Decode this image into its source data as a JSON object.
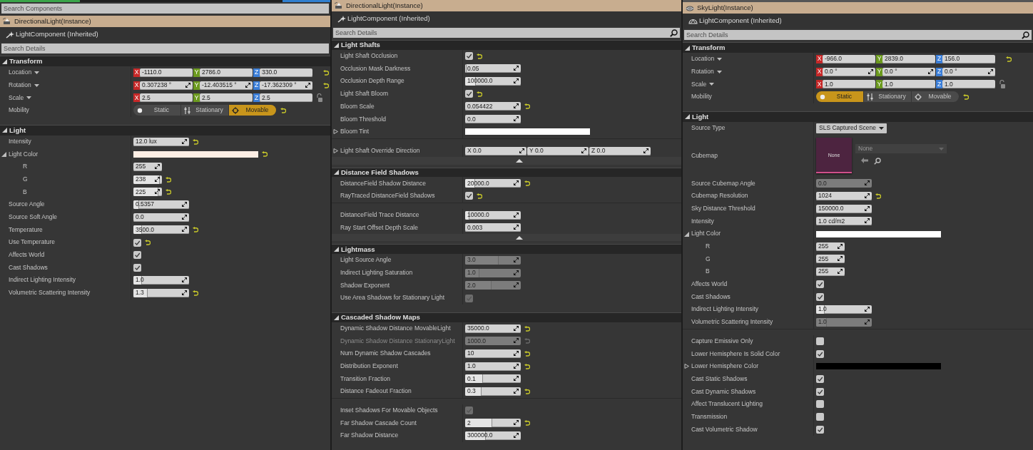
{
  "panels": [
    {
      "search_components": {
        "placeholder": "Search Components"
      },
      "actor": {
        "kind": "directional",
        "title": "DirectionalLight(Instance)"
      },
      "component": "LightComponent (Inherited)",
      "search": {
        "placeholder": "Search Details"
      },
      "sections": [
        {
          "title": "Transform",
          "expanded": true,
          "groups": [
            {
              "rows": [
                {
                  "label": "Location",
                  "kind": "vector",
                  "menu": true,
                  "reset": true,
                  "fields": [
                    {
                      "axis": "X",
                      "color": "#c62828",
                      "value": "-1110.0"
                    },
                    {
                      "axis": "Y",
                      "color": "#6c9a1f",
                      "value": "2786.0"
                    },
                    {
                      "axis": "Z",
                      "color": "#3b7ed8",
                      "value": "330.0"
                    }
                  ]
                },
                {
                  "label": "Rotation",
                  "kind": "vector",
                  "menu": true,
                  "spin": true,
                  "reset": true,
                  "fields": [
                    {
                      "axis": "X",
                      "color": "#c62828",
                      "value": "0.307238 °"
                    },
                    {
                      "axis": "Y",
                      "color": "#6c9a1f",
                      "value": "-12.403515 °"
                    },
                    {
                      "axis": "Z",
                      "color": "#3b7ed8",
                      "value": "-17.362309 °"
                    }
                  ]
                },
                {
                  "label": "Scale",
                  "kind": "vector",
                  "menu": true,
                  "lock": true,
                  "fields": [
                    {
                      "axis": "X",
                      "color": "#c62828",
                      "value": "2.5"
                    },
                    {
                      "axis": "Y",
                      "color": "#6c9a1f",
                      "value": "2.5"
                    },
                    {
                      "axis": "Z",
                      "color": "#3b7ed8",
                      "value": "2.5"
                    }
                  ]
                },
                {
                  "label": "Mobility",
                  "kind": "mobility",
                  "reset": true,
                  "options": [
                    {
                      "label": "Static",
                      "selected": false
                    },
                    {
                      "label": "Stationary",
                      "selected": false
                    },
                    {
                      "label": "Movable",
                      "selected": true
                    }
                  ]
                }
              ]
            }
          ]
        },
        {
          "title": "Light",
          "expanded": true,
          "groups": [
            {
              "rows": [
                {
                  "label": "Intensity",
                  "kind": "number",
                  "value": "12.0 lux",
                  "reset": true
                },
                {
                  "label": "Light Color",
                  "kind": "color",
                  "color": "#fdeee4",
                  "expanded": true,
                  "reset": true,
                  "children": [
                    {
                      "label": "R",
                      "kind": "number",
                      "value": "255"
                    },
                    {
                      "label": "G",
                      "kind": "number",
                      "value": "238",
                      "level": 0.93,
                      "reset": true
                    },
                    {
                      "label": "B",
                      "kind": "number",
                      "value": "225",
                      "level": 0.88,
                      "reset": true
                    }
                  ]
                },
                {
                  "label": "Source Angle",
                  "kind": "number",
                  "value": "0.5357",
                  "level": 0.1
                },
                {
                  "label": "Source Soft Angle",
                  "kind": "number",
                  "value": "0.0"
                },
                {
                  "label": "Temperature",
                  "kind": "number",
                  "value": "3500.0",
                  "level": 0.16,
                  "reset": true
                },
                {
                  "label": "Use Temperature",
                  "kind": "check",
                  "checked": true,
                  "reset": true
                },
                {
                  "label": "Affects World",
                  "kind": "check",
                  "checked": true
                },
                {
                  "label": "Cast Shadows",
                  "kind": "check",
                  "checked": true
                },
                {
                  "label": "Indirect Lighting Intensity",
                  "kind": "number",
                  "value": "1.0",
                  "level": 0.16
                },
                {
                  "label": "Volumetric Scattering Intensity",
                  "kind": "number",
                  "value": "1.3",
                  "level": 0.26,
                  "reset": true
                }
              ]
            }
          ]
        }
      ]
    },
    {
      "actor": {
        "kind": "directional",
        "title": "DirectionalLight(Instance)"
      },
      "component": "LightComponent (Inherited)",
      "search": {
        "placeholder": "Search Details",
        "button": true
      },
      "sections": [
        {
          "title": "Light Shafts",
          "expanded": true,
          "advanced": {
            "expanded": true
          },
          "groups": [
            {
              "rows": [
                {
                  "label": "Light Shaft Occlusion",
                  "kind": "check",
                  "checked": true,
                  "reset": true
                },
                {
                  "label": "Occlusion Mask Darkness",
                  "kind": "number",
                  "value": "0.05",
                  "level": 0.03
                },
                {
                  "label": "Occlusion Depth Range",
                  "kind": "number",
                  "value": "100000.0",
                  "level": 0.19
                },
                {
                  "label": "Light Shaft Bloom",
                  "kind": "check",
                  "checked": true,
                  "reset": true
                },
                {
                  "label": "Bloom Scale",
                  "kind": "number",
                  "value": "0.054422",
                  "reset": true
                },
                {
                  "label": "Bloom Threshold",
                  "kind": "number",
                  "value": "0.0"
                },
                {
                  "label": "Bloom Tint",
                  "kind": "color",
                  "color": "#ffffff",
                  "expanded": false
                }
              ]
            },
            {
              "rows": [
                {
                  "label": "Light Shaft Override Direction",
                  "kind": "vector",
                  "expanded": false,
                  "spin": true,
                  "fields": [
                    {
                      "axis": "X",
                      "value": "0.0"
                    },
                    {
                      "axis": "Y",
                      "value": "0.0"
                    },
                    {
                      "axis": "Z",
                      "value": "0.0"
                    }
                  ]
                }
              ]
            }
          ]
        },
        {
          "title": "Distance Field Shadows",
          "expanded": true,
          "advanced": {
            "expanded": true
          },
          "groups": [
            {
              "rows": [
                {
                  "label": "DistanceField Shadow Distance",
                  "kind": "number",
                  "value": "20000.0",
                  "level": 0.18,
                  "reset": true
                },
                {
                  "label": "RayTraced DistanceField Shadows",
                  "kind": "check",
                  "checked": true,
                  "reset": true
                }
              ]
            },
            {
              "rows": [
                {
                  "label": "DistanceField Trace Distance",
                  "kind": "number",
                  "value": "10000.0",
                  "level": 0.08
                },
                {
                  "label": "Ray Start Offset Depth Scale",
                  "kind": "number",
                  "value": "0.003"
                }
              ]
            }
          ]
        },
        {
          "title": "Lightmass",
          "expanded": true,
          "groups": [
            {
              "rows": [
                {
                  "label": "Light Source Angle",
                  "kind": "number",
                  "value": "3.0",
                  "level": 0.6,
                  "disabled": true
                },
                {
                  "label": "Indirect Lighting Saturation",
                  "kind": "number",
                  "value": "1.0",
                  "level": 0.25,
                  "disabled": true
                },
                {
                  "label": "Shadow Exponent",
                  "kind": "number",
                  "value": "2.0",
                  "level": 0.48,
                  "disabled": true
                },
                {
                  "label": "Use Area Shadows for Stationary Light",
                  "kind": "check",
                  "checked": true,
                  "disabled": true
                }
              ]
            }
          ]
        },
        {
          "title": "Cascaded Shadow Maps",
          "expanded": true,
          "groups": [
            {
              "rows": [
                {
                  "label": "Dynamic Shadow Distance MovableLight",
                  "kind": "number",
                  "value": "35000.0",
                  "reset": true
                },
                {
                  "label": "Dynamic Shadow Distance StationaryLight",
                  "kind": "number",
                  "value": "1000.0",
                  "disabled": true,
                  "label_greyed": true,
                  "reset": true
                },
                {
                  "label": "Num Dynamic Shadow Cascades",
                  "kind": "number",
                  "value": "10",
                  "reset": true
                },
                {
                  "label": "Distribution Exponent",
                  "kind": "number",
                  "value": "1.0",
                  "reset": true
                },
                {
                  "label": "Transition Fraction",
                  "kind": "number",
                  "value": "0.1",
                  "level": 0.32
                },
                {
                  "label": "Distance Fadeout Fraction",
                  "kind": "number",
                  "value": "0.3",
                  "level": 0.3,
                  "reset": true
                }
              ]
            },
            {
              "rows": [
                {
                  "label": "Inset Shadows For Movable Objects",
                  "kind": "check",
                  "checked": true,
                  "disabled": true
                },
                {
                  "label": "Far Shadow Cascade Count",
                  "kind": "number",
                  "value": "2",
                  "level": 0.49,
                  "reset": true
                },
                {
                  "label": "Far Shadow Distance",
                  "kind": "number",
                  "value": "300000.0",
                  "level": 0.37
                }
              ]
            }
          ]
        }
      ]
    },
    {
      "actor": {
        "kind": "sky",
        "title": "SkyLight(Instance)"
      },
      "component": "LightComponent (Inherited)",
      "search": {
        "placeholder": "Search Details",
        "button": true
      },
      "sections": [
        {
          "title": "Transform",
          "expanded": true,
          "groups": [
            {
              "rows": [
                {
                  "label": "Location",
                  "kind": "vector",
                  "menu": true,
                  "reset": true,
                  "fields": [
                    {
                      "axis": "X",
                      "color": "#c62828",
                      "value": "-966.0"
                    },
                    {
                      "axis": "Y",
                      "color": "#6c9a1f",
                      "value": "2839.0"
                    },
                    {
                      "axis": "Z",
                      "color": "#3b7ed8",
                      "value": "156.0"
                    }
                  ]
                },
                {
                  "label": "Rotation",
                  "kind": "vector",
                  "menu": true,
                  "spin": true,
                  "fields": [
                    {
                      "axis": "X",
                      "color": "#c62828",
                      "value": "0.0 °"
                    },
                    {
                      "axis": "Y",
                      "color": "#6c9a1f",
                      "value": "0.0 °"
                    },
                    {
                      "axis": "Z",
                      "color": "#3b7ed8",
                      "value": "0.0 °"
                    }
                  ]
                },
                {
                  "label": "Scale",
                  "kind": "vector",
                  "menu": true,
                  "lock": true,
                  "fields": [
                    {
                      "axis": "X",
                      "color": "#c62828",
                      "value": "1.0"
                    },
                    {
                      "axis": "Y",
                      "color": "#6c9a1f",
                      "value": "1.0"
                    },
                    {
                      "axis": "Z",
                      "color": "#3b7ed8",
                      "value": "1.0"
                    }
                  ]
                },
                {
                  "label": "Mobility",
                  "kind": "mobility",
                  "reset": true,
                  "options": [
                    {
                      "label": "Static",
                      "selected": true
                    },
                    {
                      "label": "Stationary",
                      "selected": false
                    },
                    {
                      "label": "Movable",
                      "selected": false
                    }
                  ]
                }
              ]
            }
          ]
        },
        {
          "title": "Light",
          "expanded": true,
          "groups": [
            {
              "rows": [
                {
                  "label": "Source Type",
                  "kind": "dropdown",
                  "value": "SLS Captured Scene"
                },
                {
                  "label": "Cubemap",
                  "kind": "cubemap",
                  "thumbnail": "None",
                  "asset": "None"
                },
                {
                  "label": "Source Cubemap Angle",
                  "kind": "number",
                  "value": "0.0",
                  "disabled": true
                },
                {
                  "label": "Cubemap Resolution",
                  "kind": "number",
                  "value": "1024",
                  "reset": true
                },
                {
                  "label": "Sky Distance Threshold",
                  "kind": "number",
                  "value": "150000.0"
                },
                {
                  "label": "Intensity",
                  "kind": "number",
                  "value": "1.0 cd/m2"
                },
                {
                  "label": "Light Color",
                  "kind": "color",
                  "color": "#ffffff",
                  "expanded": true,
                  "children": [
                    {
                      "label": "R",
                      "kind": "number",
                      "value": "255"
                    },
                    {
                      "label": "G",
                      "kind": "number",
                      "value": "255"
                    },
                    {
                      "label": "B",
                      "kind": "number",
                      "value": "255"
                    }
                  ]
                },
                {
                  "label": "Affects World",
                  "kind": "check",
                  "checked": true
                },
                {
                  "label": "Cast Shadows",
                  "kind": "check",
                  "checked": true
                },
                {
                  "label": "Indirect Lighting Intensity",
                  "kind": "number",
                  "value": "1.0",
                  "level": 0.16
                },
                {
                  "label": "Volumetric Scattering Intensity",
                  "kind": "number",
                  "value": "1.0",
                  "level": 0.19,
                  "disabled": true
                }
              ]
            },
            {
              "rows": [
                {
                  "label": "Capture Emissive Only",
                  "kind": "check",
                  "checked": false
                },
                {
                  "label": "Lower Hemisphere Is Solid Color",
                  "kind": "check",
                  "checked": true
                },
                {
                  "label": "Lower Hemisphere Color",
                  "kind": "color",
                  "color": "#000000",
                  "expanded": false
                },
                {
                  "label": "Cast Static Shadows",
                  "kind": "check",
                  "checked": true
                },
                {
                  "label": "Cast Dynamic Shadows",
                  "kind": "check",
                  "checked": true
                },
                {
                  "label": "Affect Translucent Lighting",
                  "kind": "check",
                  "checked": false
                },
                {
                  "label": "Transmission",
                  "kind": "check",
                  "checked": false
                },
                {
                  "label": "Cast Volumetric Shadow",
                  "kind": "check",
                  "checked": true
                }
              ]
            }
          ]
        }
      ]
    }
  ]
}
